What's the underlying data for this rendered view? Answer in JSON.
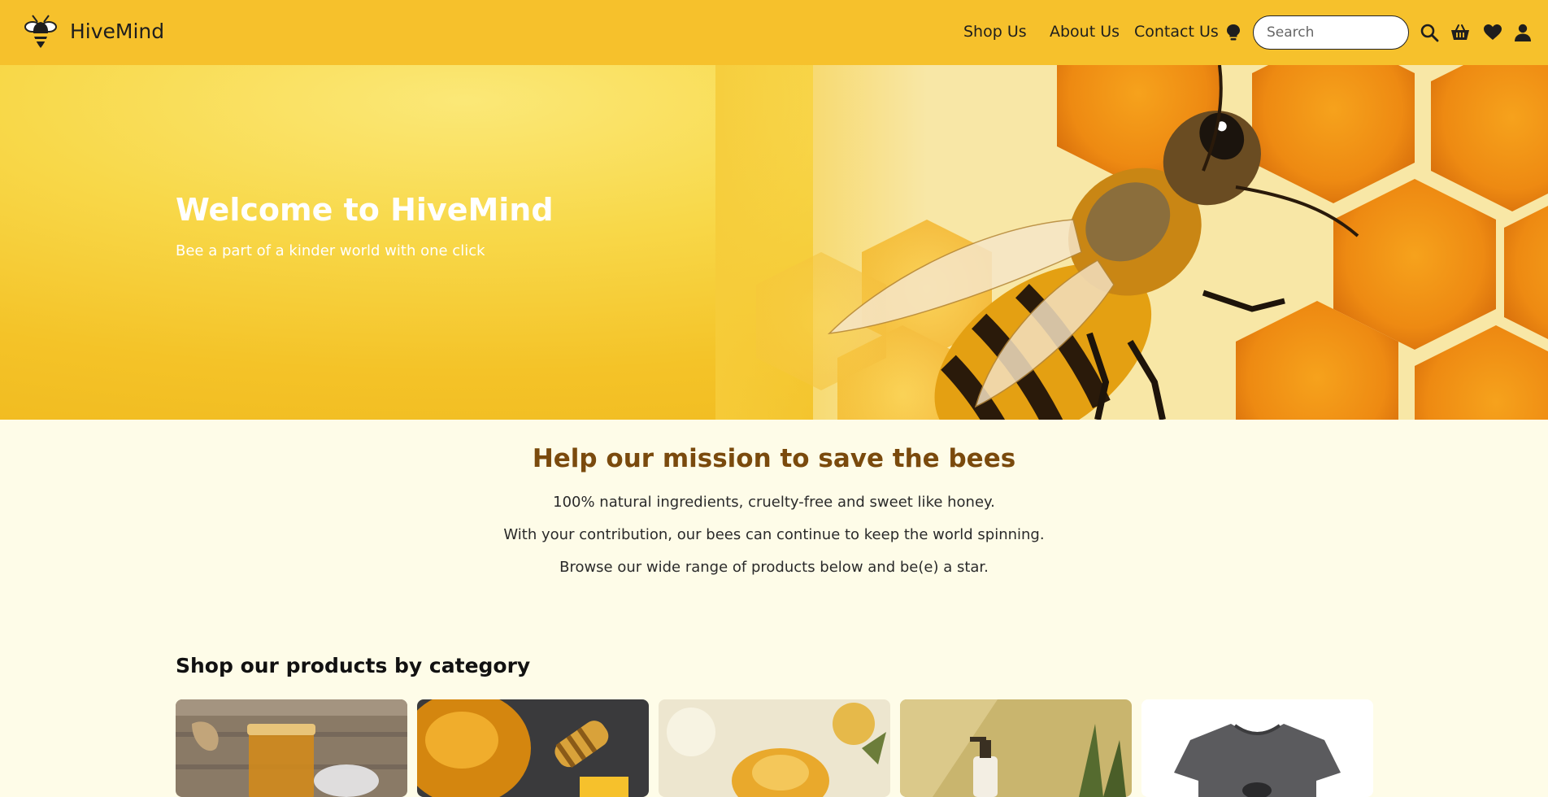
{
  "header": {
    "brand": "HiveMind",
    "nav": [
      "Shop Us",
      "About Us",
      "Contact Us"
    ],
    "search_placeholder": "Search"
  },
  "hero": {
    "title": "Welcome to HiveMind",
    "subtitle": "Bee a part of a kinder world with one click"
  },
  "mission": {
    "title": "Help our mission to save the bees",
    "lines": [
      "100% natural ingredients, cruelty-free and sweet like honey.",
      "With your contribution, our bees can continue to keep the world spinning.",
      "Browse our wide range of products below and be(e) a star."
    ]
  },
  "categories": {
    "heading": "Shop our products by category"
  },
  "colors": {
    "navbar": "#f6c12c",
    "page_bg": "#fefce8",
    "mission_title": "#7a4a0d"
  },
  "icons": [
    "bee-logo-icon",
    "lightbulb-icon",
    "search-icon",
    "basket-icon",
    "heart-icon",
    "user-icon"
  ]
}
